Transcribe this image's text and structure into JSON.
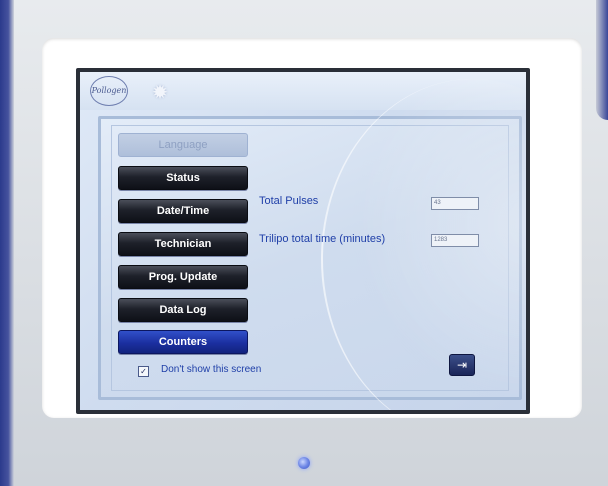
{
  "brand": {
    "logo_text": "Pollogen"
  },
  "menu": {
    "items": [
      {
        "label": "Language",
        "state": "disabled"
      },
      {
        "label": "Status",
        "state": "normal"
      },
      {
        "label": "Date/Time",
        "state": "normal"
      },
      {
        "label": "Technician",
        "state": "normal"
      },
      {
        "label": "Prog. Update",
        "state": "normal"
      },
      {
        "label": "Data Log",
        "state": "normal"
      },
      {
        "label": "Counters",
        "state": "active"
      }
    ]
  },
  "counters": {
    "total_pulses_label": "Total Pulses",
    "total_pulses_value": "43",
    "trilipo_time_label": "Trilipo total time (minutes)",
    "trilipo_time_value": "1283"
  },
  "footer": {
    "dont_show_checked": true,
    "dont_show_label": "Don't show this screen"
  },
  "icons": {
    "settings": "gear-icon",
    "exit": "exit-icon",
    "checkbox_mark": "✓"
  },
  "colors": {
    "accent_blue": "#1f3fa8",
    "active_button": "#1b2fa0",
    "button_dark": "#1e212a"
  }
}
